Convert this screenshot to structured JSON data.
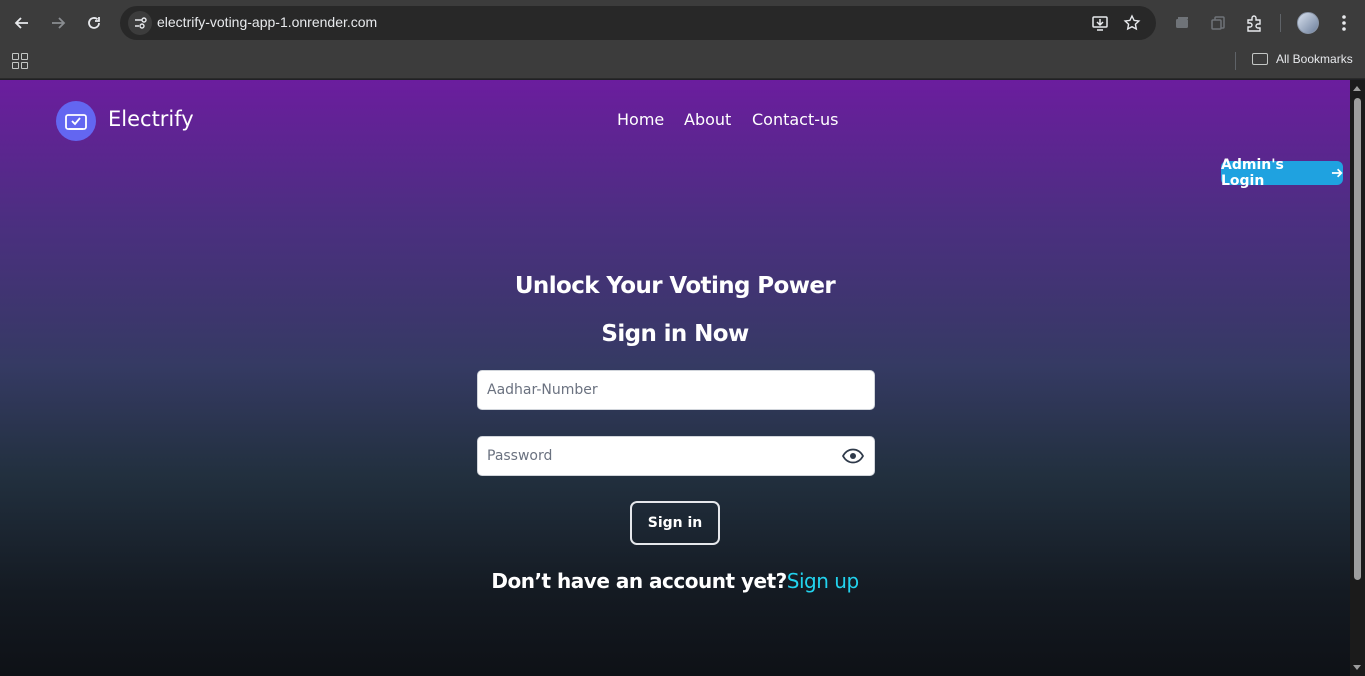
{
  "browser": {
    "url": "electrify-voting-app-1.onrender.com",
    "bookmarks_label": "All Bookmarks"
  },
  "nav": {
    "brand": "Electrify",
    "links": [
      "Home",
      "About",
      "Contact-us"
    ],
    "admin_button": "Admin's Login"
  },
  "main": {
    "heading": "Unlock Your Voting Power",
    "subheading": "Sign in Now",
    "aadhar_placeholder": "Aadhar-Number",
    "password_placeholder": "Password",
    "signin_button": "Sign in",
    "signup_prompt": "Don’t have an account yet?",
    "signup_link": "Sign up"
  },
  "colors": {
    "accent": "#6366f1",
    "admin_button": "#1fa2e0",
    "signup_link": "#22d3ee",
    "gradient_top": "#6b1d9e",
    "gradient_bottom": "#0e1116"
  },
  "icons": [
    "back-icon",
    "forward-icon",
    "reload-icon",
    "site-info-icon",
    "install-icon",
    "star-icon",
    "extensions-icon",
    "menu-icon",
    "apps-icon",
    "folder-icon",
    "ballot-icon",
    "arrow-right-icon",
    "eye-icon"
  ]
}
